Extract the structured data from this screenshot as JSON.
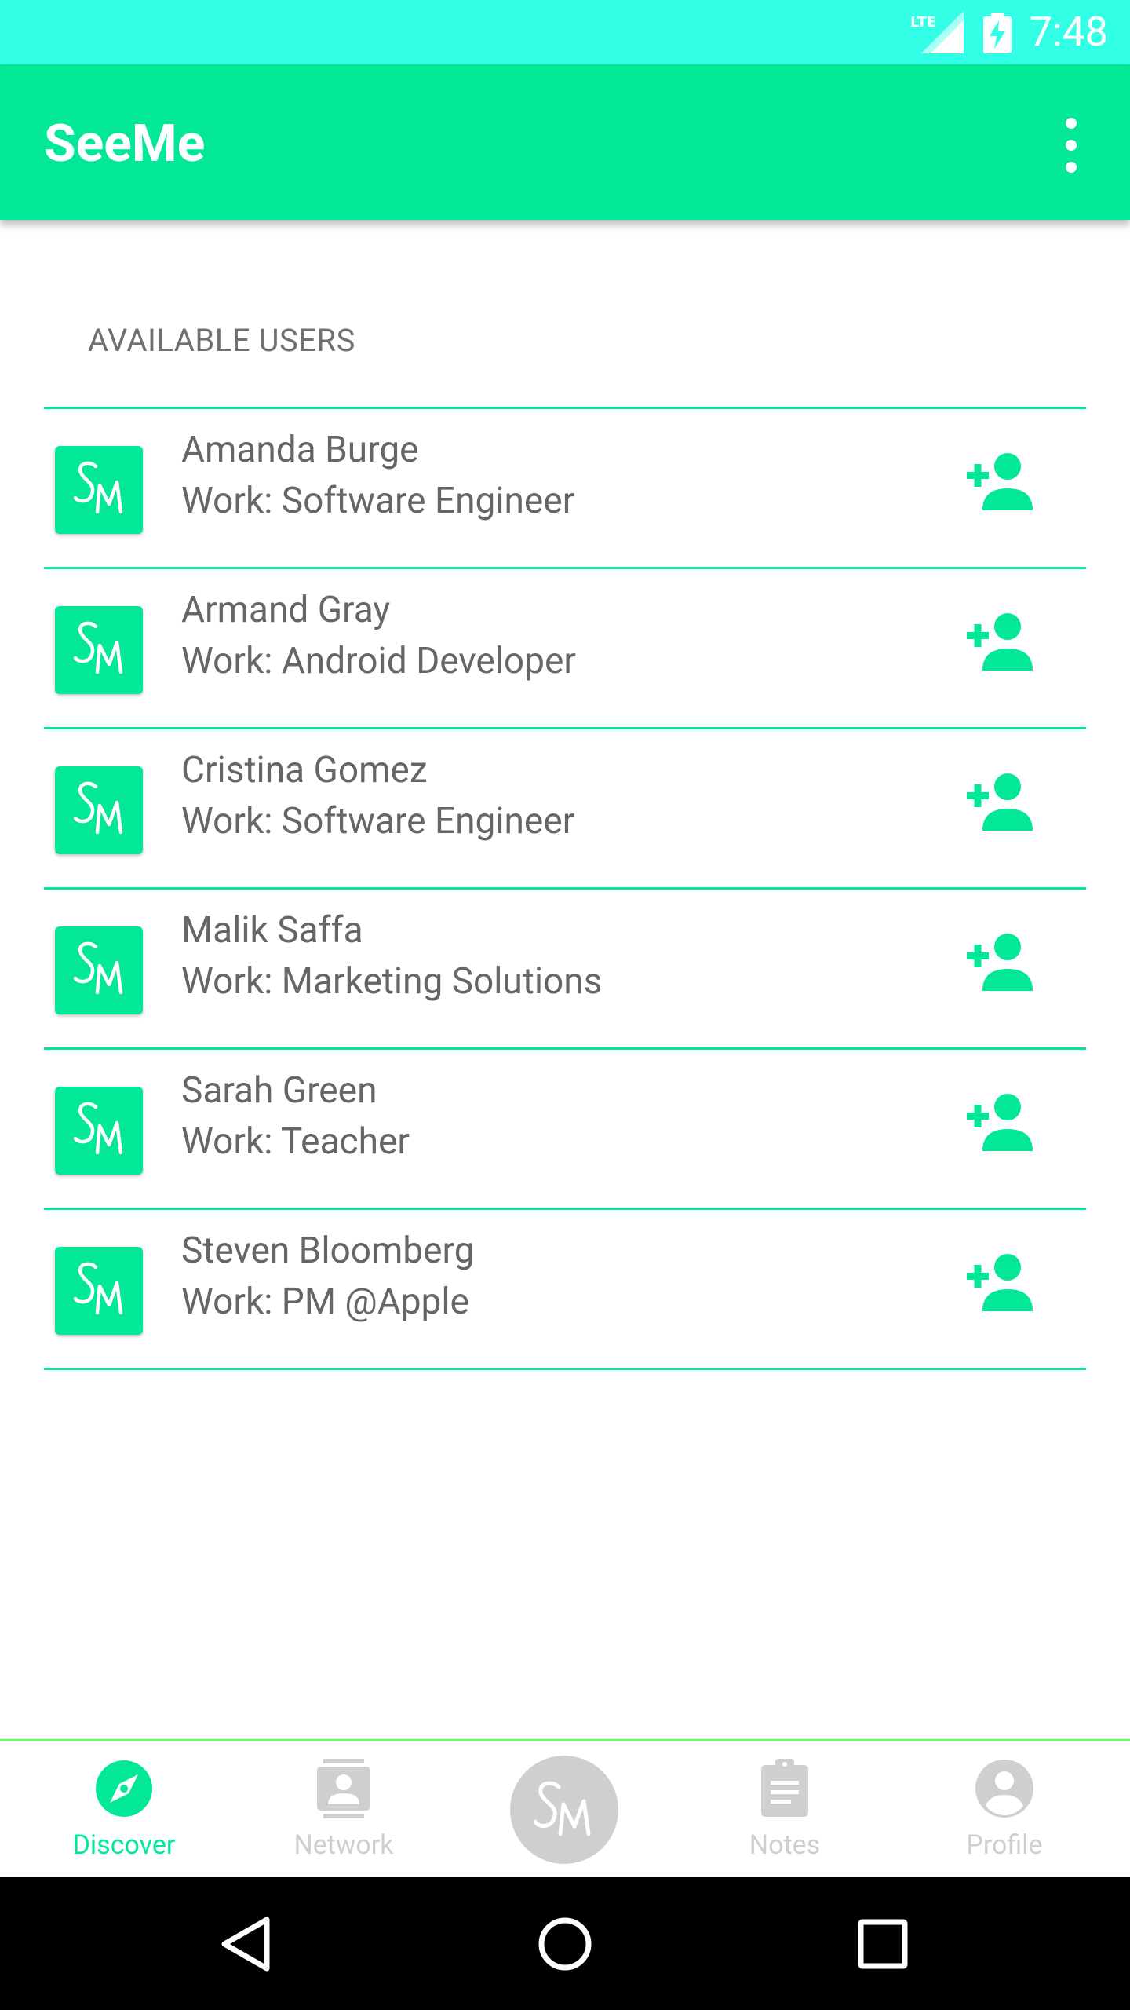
{
  "status_bar": {
    "time": "7:48",
    "network": "LTE",
    "signal_icon": "signal-icon",
    "battery_icon": "battery-charging-icon"
  },
  "app_bar": {
    "title": "SeeMe",
    "menu_icon": "more-vert-icon"
  },
  "section": {
    "header": "AVAILABLE USERS"
  },
  "users": [
    {
      "name": "Amanda Burge",
      "work": "Work: Software Engineer"
    },
    {
      "name": "Armand Gray",
      "work": "Work: Android Developer"
    },
    {
      "name": "Cristina Gomez",
      "work": "Work: Software Engineer"
    },
    {
      "name": "Malik Saffa",
      "work": "Work: Marketing Solutions"
    },
    {
      "name": "Sarah Green",
      "work": "Work: Teacher"
    },
    {
      "name": "Steven Bloomberg",
      "work": "Work: PM @Apple"
    }
  ],
  "avatar_logo": "SM",
  "bottom_nav": {
    "items": [
      {
        "label": "Discover",
        "icon": "compass-icon",
        "active": true
      },
      {
        "label": "Network",
        "icon": "contacts-icon",
        "active": false
      },
      {
        "label": "",
        "icon": "seeme-logo-icon",
        "active": false
      },
      {
        "label": "Notes",
        "icon": "clipboard-icon",
        "active": false
      },
      {
        "label": "Profile",
        "icon": "account-circle-icon",
        "active": false
      }
    ]
  },
  "colors": {
    "status_bar": "#33ffe6",
    "primary": "#03e896",
    "text_secondary": "#666666",
    "inactive": "#cfcfcf",
    "nav_border": "#66ff66"
  }
}
